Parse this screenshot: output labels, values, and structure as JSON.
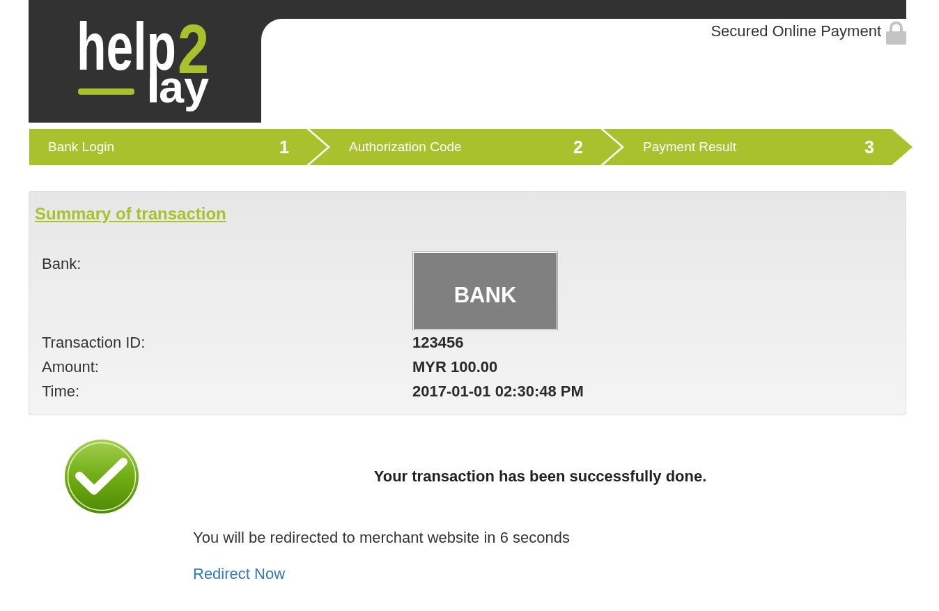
{
  "header": {
    "logo": {
      "word": "help",
      "digit": "2",
      "tail": "ay"
    },
    "secure_label": "Secured Online Payment"
  },
  "steps": [
    {
      "label": "Bank Login",
      "number": "1"
    },
    {
      "label": "Authorization Code",
      "number": "2"
    },
    {
      "label": "Payment Result",
      "number": "3"
    }
  ],
  "summary": {
    "title": "Summary of transaction",
    "rows": [
      {
        "kind": "logo",
        "label": "Bank:",
        "value": "BANK"
      },
      {
        "kind": "text",
        "label": "Transaction ID:",
        "value": "123456"
      },
      {
        "kind": "text",
        "label": "Amount:",
        "value": "MYR 100.00"
      },
      {
        "kind": "text",
        "label": "Time:",
        "value": "2017-01-01 02:30:48 PM"
      }
    ]
  },
  "result": {
    "succeeded": true,
    "message": "Your transaction has been successfully done.",
    "redirect_text": "You will be redirected to merchant website in 6 seconds",
    "redirect_link": "Redirect Now"
  }
}
